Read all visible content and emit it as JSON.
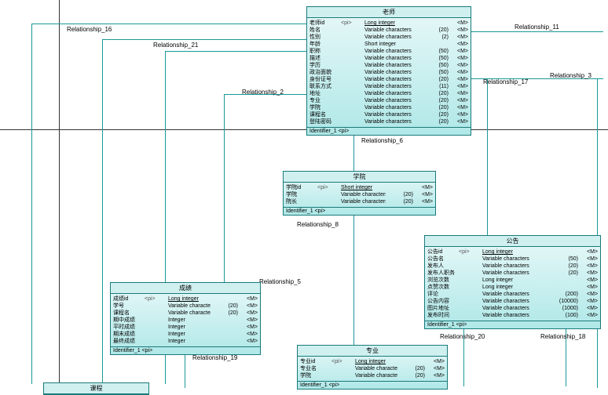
{
  "grid": {
    "v1": 75,
    "h1": 165
  },
  "relationships": {
    "r16": "Relationship_16",
    "r21": "Relationship_21",
    "r2": "Relationship_2",
    "r11": "Relationship_11",
    "r17": "Relationship_17",
    "r3": "Relationship_3",
    "r6": "Relationship_6",
    "r8": "Relationship_8",
    "r5": "Relationship_5",
    "r19": "Relationship_19",
    "r20": "Relationship_20",
    "r18": "Relationship_18"
  },
  "entities": {
    "teacher": {
      "title": "老师",
      "footer": "Identifier_1 <pi>",
      "rows": [
        {
          "name": "老师id",
          "key": "<pi>",
          "type": "Long integer",
          "size": "",
          "m": "<M>",
          "u": true
        },
        {
          "name": "姓名",
          "key": "",
          "type": "Variable characters",
          "size": "(20)",
          "m": "<M>"
        },
        {
          "name": "性别",
          "key": "",
          "type": "Variable characters",
          "size": "(2)",
          "m": "<M>"
        },
        {
          "name": "年龄",
          "key": "",
          "type": "Short integer",
          "size": "",
          "m": "<M>"
        },
        {
          "name": "职称",
          "key": "",
          "type": "Variable characters",
          "size": "(50)",
          "m": "<M>"
        },
        {
          "name": "描述",
          "key": "",
          "type": "Variable characters",
          "size": "(50)",
          "m": "<M>"
        },
        {
          "name": "学历",
          "key": "",
          "type": "Variable characters",
          "size": "(50)",
          "m": "<M>"
        },
        {
          "name": "政治面貌",
          "key": "",
          "type": "Variable characters",
          "size": "(50)",
          "m": "<M>"
        },
        {
          "name": "身份证号",
          "key": "",
          "type": "Variable characters",
          "size": "(20)",
          "m": "<M>"
        },
        {
          "name": "联系方式",
          "key": "",
          "type": "Variable characters",
          "size": "(11)",
          "m": "<M>"
        },
        {
          "name": "地址",
          "key": "",
          "type": "Variable characters",
          "size": "(20)",
          "m": "<M>"
        },
        {
          "name": "专业",
          "key": "",
          "type": "Variable characters",
          "size": "(20)",
          "m": "<M>"
        },
        {
          "name": "学院",
          "key": "",
          "type": "Variable characters",
          "size": "(20)",
          "m": "<M>"
        },
        {
          "name": "课程名",
          "key": "",
          "type": "Variable characters",
          "size": "(20)",
          "m": "<M>"
        },
        {
          "name": "登陆密码",
          "key": "",
          "type": "Variable characters",
          "size": "(20)",
          "m": "<M>"
        }
      ]
    },
    "college": {
      "title": "学院",
      "footer": "Identifier_1 <pi>",
      "rows": [
        {
          "name": "学院id",
          "key": "<pi>",
          "type": "Short integer",
          "size": "",
          "m": "<M>",
          "u": true
        },
        {
          "name": "学院",
          "key": "",
          "type": "Variable characters",
          "size": "(20)",
          "m": "<M>"
        },
        {
          "name": "院长",
          "key": "",
          "type": "Variable characters",
          "size": "(20)",
          "m": "<M>"
        }
      ]
    },
    "notice": {
      "title": "公告",
      "footer": "Identifier_1 <pi>",
      "rows": [
        {
          "name": "公告id",
          "key": "<pi>",
          "type": "Long integer",
          "size": "",
          "m": "<M>",
          "u": true
        },
        {
          "name": "公告名",
          "key": "",
          "type": "Variable characters",
          "size": "(50)",
          "m": "<M>"
        },
        {
          "name": "发布人",
          "key": "",
          "type": "Variable characters",
          "size": "(20)",
          "m": "<M>"
        },
        {
          "name": "发布人职务",
          "key": "",
          "type": "Variable characters",
          "size": "(20)",
          "m": "<M>"
        },
        {
          "name": "浏览次数",
          "key": "",
          "type": "Long integer",
          "size": "",
          "m": "<M>"
        },
        {
          "name": "点赞次数",
          "key": "",
          "type": "Long integer",
          "size": "",
          "m": "<M>"
        },
        {
          "name": "评论",
          "key": "",
          "type": "Variable characters",
          "size": "(200)",
          "m": "<M>"
        },
        {
          "name": "公告内容",
          "key": "",
          "type": "Variable characters",
          "size": "(10000)",
          "m": "<M>"
        },
        {
          "name": "图片地址",
          "key": "",
          "type": "Variable characters",
          "size": "(1000)",
          "m": "<M>"
        },
        {
          "name": "发布时间",
          "key": "",
          "type": "Variable characters",
          "size": "(100)",
          "m": "<M>"
        }
      ]
    },
    "grade": {
      "title": "成绩",
      "footer": "Identifier_1 <pi>",
      "rows": [
        {
          "name": "成绩id",
          "key": "<pi>",
          "type": "Long integer",
          "size": "",
          "m": "<M>",
          "u": true
        },
        {
          "name": "学号",
          "key": "",
          "type": "Variable characters",
          "size": "(20)",
          "m": "<M>"
        },
        {
          "name": "课程名",
          "key": "",
          "type": "Variable characters",
          "size": "(20)",
          "m": "<M>"
        },
        {
          "name": "期中成绩",
          "key": "",
          "type": "Integer",
          "size": "",
          "m": "<M>"
        },
        {
          "name": "平时成绩",
          "key": "",
          "type": "Integer",
          "size": "",
          "m": "<M>"
        },
        {
          "name": "期末成绩",
          "key": "",
          "type": "Integer",
          "size": "",
          "m": "<M>"
        },
        {
          "name": "最终成绩",
          "key": "",
          "type": "Integer",
          "size": "",
          "m": "<M>"
        }
      ]
    },
    "major": {
      "title": "专业",
      "footer": "Identifier_1 <pi>",
      "rows": [
        {
          "name": "专业id",
          "key": "<pi>",
          "type": "Long integer",
          "size": "",
          "m": "<M>",
          "u": true
        },
        {
          "name": "专业名",
          "key": "",
          "type": "Variable characters",
          "size": "(20)",
          "m": "<M>"
        },
        {
          "name": "学院",
          "key": "",
          "type": "Variable characters",
          "size": "(20)",
          "m": "<M>"
        }
      ]
    },
    "course": {
      "title": "课程"
    }
  }
}
